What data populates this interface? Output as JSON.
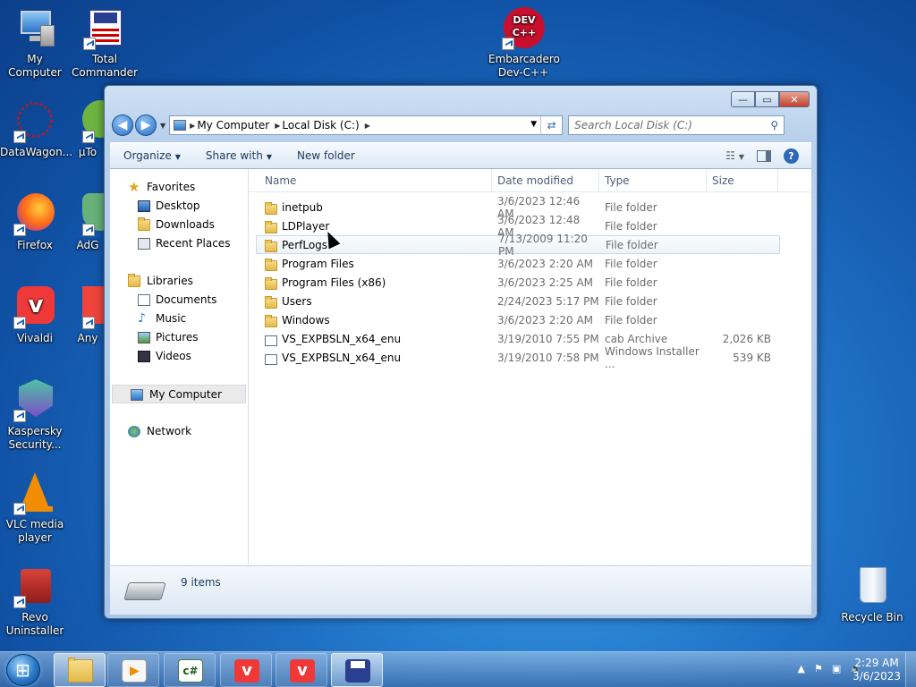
{
  "desktop": {
    "icons": [
      {
        "name": "my-computer",
        "label": "My Computer"
      },
      {
        "name": "total-commander",
        "label": "Total Commander"
      },
      {
        "name": "embarcadero-devcpp",
        "label": "Embarcadero Dev-C++",
        "logo_text": "DEV C++"
      },
      {
        "name": "datawagon",
        "label": "DataWagon..."
      },
      {
        "name": "utorrent",
        "label": "µTo"
      },
      {
        "name": "firefox",
        "label": "Firefox"
      },
      {
        "name": "adguard",
        "label": "AdG"
      },
      {
        "name": "vivaldi",
        "label": "Vivaldi"
      },
      {
        "name": "anydesk",
        "label": "Any"
      },
      {
        "name": "kaspersky",
        "label": "Kaspersky Security..."
      },
      {
        "name": "vlc",
        "label": "VLC media player"
      },
      {
        "name": "revo",
        "label": "Revo Uninstaller"
      },
      {
        "name": "recycle-bin",
        "label": "Recycle Bin"
      }
    ]
  },
  "window": {
    "controls": {
      "minimize": "—",
      "maximize": "▭",
      "close": "✕"
    },
    "address": {
      "crumbs": [
        "My Computer",
        "Local Disk (C:)"
      ]
    },
    "search": {
      "placeholder": "Search Local Disk (C:)"
    },
    "toolbar": {
      "organize": "Organize",
      "share_with": "Share with",
      "new_folder": "New folder"
    },
    "nav_pane": {
      "favorites": {
        "label": "Favorites",
        "items": [
          "Desktop",
          "Downloads",
          "Recent Places"
        ]
      },
      "libraries": {
        "label": "Libraries",
        "items": [
          "Documents",
          "Music",
          "Pictures",
          "Videos"
        ]
      },
      "my_computer": "My Computer",
      "network": "Network"
    },
    "columns": {
      "name": "Name",
      "date": "Date modified",
      "type": "Type",
      "size": "Size"
    },
    "files": [
      {
        "name": "inetpub",
        "date": "3/6/2023 12:46 AM",
        "type": "File folder",
        "size": "",
        "kind": "folder"
      },
      {
        "name": "LDPlayer",
        "date": "3/6/2023 12:48 AM",
        "type": "File folder",
        "size": "",
        "kind": "folder"
      },
      {
        "name": "PerfLogs",
        "date": "7/13/2009 11:20 PM",
        "type": "File folder",
        "size": "",
        "kind": "folder"
      },
      {
        "name": "Program Files",
        "date": "3/6/2023 2:20 AM",
        "type": "File folder",
        "size": "",
        "kind": "folder"
      },
      {
        "name": "Program Files (x86)",
        "date": "3/6/2023 2:25 AM",
        "type": "File folder",
        "size": "",
        "kind": "folder"
      },
      {
        "name": "Users",
        "date": "2/24/2023 5:17 PM",
        "type": "File folder",
        "size": "",
        "kind": "folder"
      },
      {
        "name": "Windows",
        "date": "3/6/2023 2:20 AM",
        "type": "File folder",
        "size": "",
        "kind": "folder"
      },
      {
        "name": "VS_EXPBSLN_x64_enu",
        "date": "3/19/2010 7:55 PM",
        "type": "cab Archive",
        "size": "2,026 KB",
        "kind": "cab"
      },
      {
        "name": "VS_EXPBSLN_x64_enu",
        "date": "3/19/2010 7:58 PM",
        "type": "Windows Installer ...",
        "size": "539 KB",
        "kind": "msi"
      }
    ],
    "status": "9 items"
  },
  "taskbar": {
    "clock_time": "2:29 AM",
    "clock_date": "3/6/2023"
  }
}
